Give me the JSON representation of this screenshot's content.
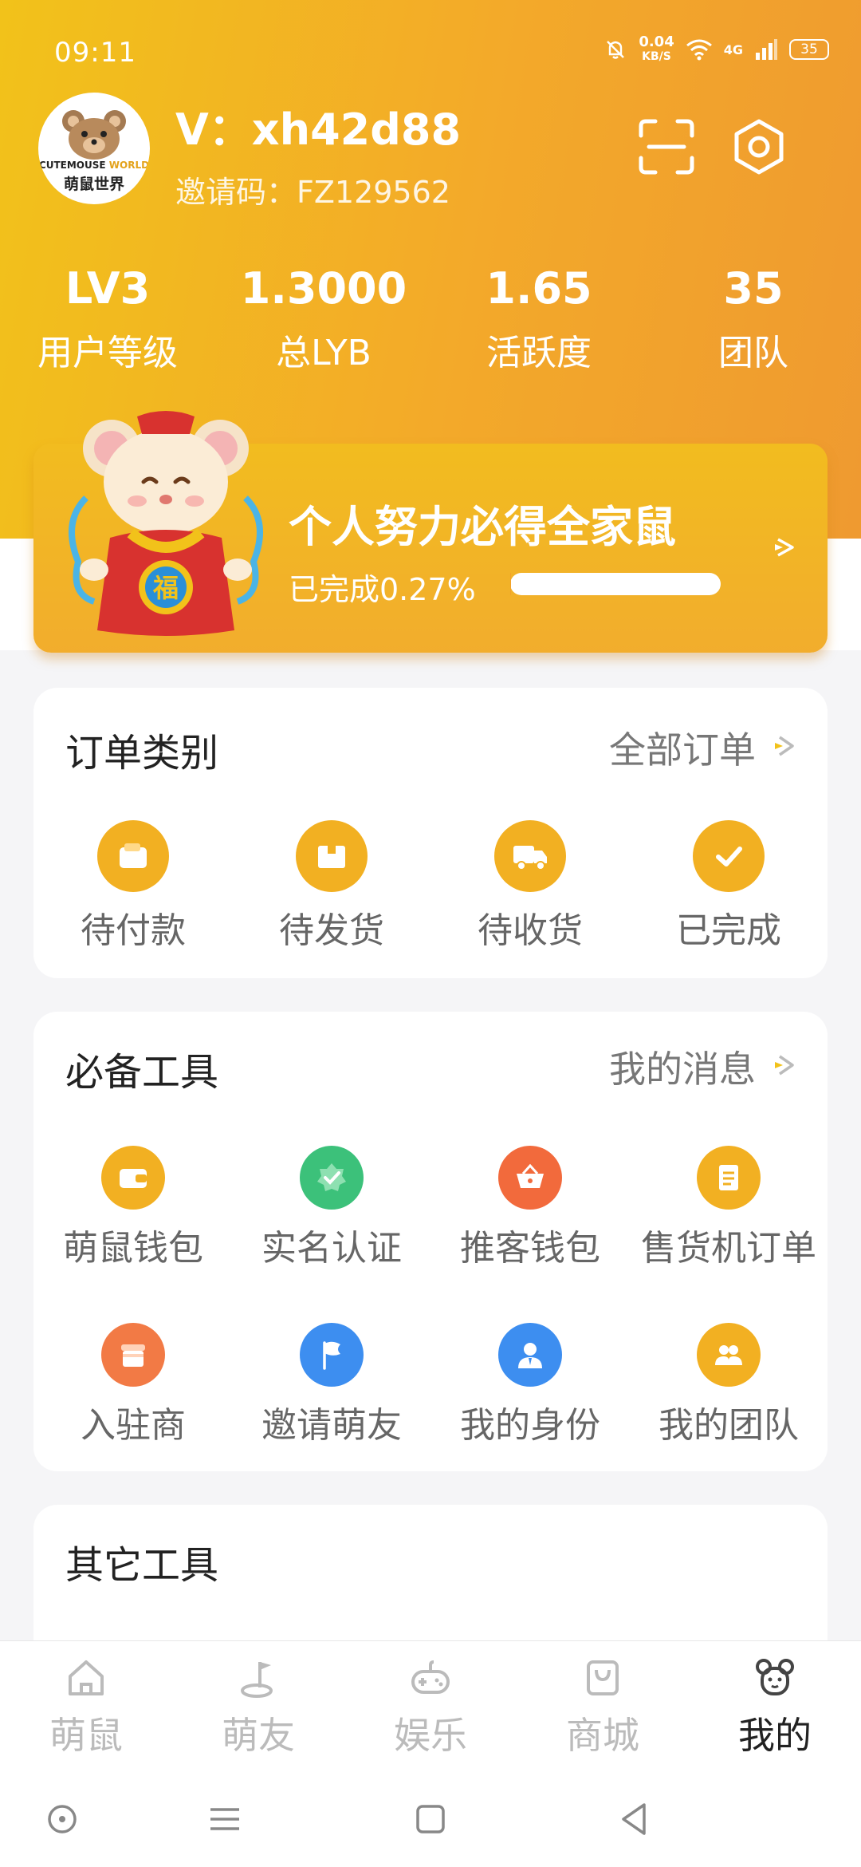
{
  "status_bar": {
    "time": "09:11",
    "net_speed": "0.04",
    "net_unit": "KB/S",
    "network": "4G",
    "battery": "35"
  },
  "profile": {
    "avatar_brand_1": "CUTEMOUSE",
    "avatar_brand_2": "WORLD",
    "avatar_brand_cn": "萌鼠世界",
    "username": "V：xh42d88",
    "invite_code": "邀请码：FZ129562"
  },
  "stats": [
    {
      "value": "LV3",
      "label": "用户等级"
    },
    {
      "value": "1.3000",
      "label": "总LYB"
    },
    {
      "value": "1.65",
      "label": "活跃度"
    },
    {
      "value": "35",
      "label": "团队"
    }
  ],
  "banner": {
    "title": "个人努力必得全家鼠",
    "progress_text": "已完成0.27%",
    "progress_percent": 0.27,
    "mascot_char": "福"
  },
  "orders": {
    "title": "订单类别",
    "link": "全部订单",
    "items": [
      {
        "label": "待付款",
        "icon": "wallet-icon"
      },
      {
        "label": "待发货",
        "icon": "box-icon"
      },
      {
        "label": "待收货",
        "icon": "truck-icon"
      },
      {
        "label": "已完成",
        "icon": "check-icon"
      }
    ]
  },
  "tools": {
    "title": "必备工具",
    "link": "我的消息",
    "items": [
      {
        "label": "萌鼠钱包",
        "icon": "wallet-icon"
      },
      {
        "label": "实名认证",
        "icon": "verified-icon"
      },
      {
        "label": "推客钱包",
        "icon": "basket-icon"
      },
      {
        "label": "售货机订单",
        "icon": "receipt-icon"
      },
      {
        "label": "入驻商",
        "icon": "store-icon"
      },
      {
        "label": "邀请萌友",
        "icon": "flag-icon"
      },
      {
        "label": "我的身份",
        "icon": "person-icon"
      },
      {
        "label": "我的团队",
        "icon": "team-icon"
      }
    ]
  },
  "other_tools": {
    "title": "其它工具"
  },
  "bottom_nav": [
    {
      "label": "萌鼠",
      "icon": "home-icon"
    },
    {
      "label": "萌友",
      "icon": "friends-icon"
    },
    {
      "label": "娱乐",
      "icon": "gamepad-icon"
    },
    {
      "label": "商城",
      "icon": "shop-bag-icon"
    },
    {
      "label": "我的",
      "icon": "mouse-face-icon",
      "active": true
    }
  ],
  "colors": {
    "brand_yellow": "#f2c21a",
    "brand_orange": "#ef9a30",
    "icon_orange": "#f2a92a",
    "icon_green": "#3cc17a",
    "icon_red_orange": "#f26a3c",
    "icon_blue": "#3d8ef0"
  }
}
